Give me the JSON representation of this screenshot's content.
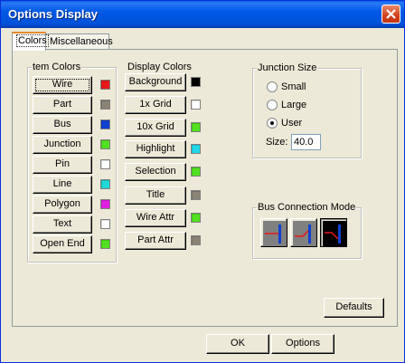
{
  "window": {
    "title": "Options Display"
  },
  "tabs": [
    {
      "label": "Colors",
      "active": true
    },
    {
      "label": "Miscellaneous",
      "active": false
    }
  ],
  "item_colors": {
    "group_label": "tem Colors",
    "items": [
      {
        "label": "Wire",
        "color": "#e81818"
      },
      {
        "label": "Part",
        "color": "#8b8378"
      },
      {
        "label": "Bus",
        "color": "#1040d0"
      },
      {
        "label": "Junction",
        "color": "#52e020"
      },
      {
        "label": "Pin",
        "color": "#ffffff"
      },
      {
        "label": "Line",
        "color": "#20d8d8"
      },
      {
        "label": "Polygon",
        "color": "#e020e0"
      },
      {
        "label": "Text",
        "color": "#ffffff"
      },
      {
        "label": "Open End",
        "color": "#52e020"
      }
    ]
  },
  "display_colors": {
    "group_label": "Display Colors",
    "items": [
      {
        "label": "Background",
        "color": "#000000"
      },
      {
        "label": "1x Grid",
        "color": "#ffffff"
      },
      {
        "label": "10x Grid",
        "color": "#52e020"
      },
      {
        "label": "Highlight",
        "color": "#20d8e8"
      },
      {
        "label": "Selection",
        "color": "#52e020"
      },
      {
        "label": "Title",
        "color": "#8b8378"
      },
      {
        "label": "Wire Attr",
        "color": "#52e020"
      },
      {
        "label": "Part Attr",
        "color": "#8b8378"
      }
    ]
  },
  "junction_size": {
    "group_label": "Junction Size",
    "options": [
      {
        "label": "Small",
        "selected": false
      },
      {
        "label": "Large",
        "selected": false
      },
      {
        "label": "User",
        "selected": true
      }
    ],
    "size_label": "Size:",
    "size_value": "40.0"
  },
  "bus_connection_mode": {
    "group_label": "Bus Connection Mode",
    "selected_index": 2
  },
  "buttons": {
    "defaults": "Defaults",
    "ok": "OK",
    "options": "Options"
  }
}
